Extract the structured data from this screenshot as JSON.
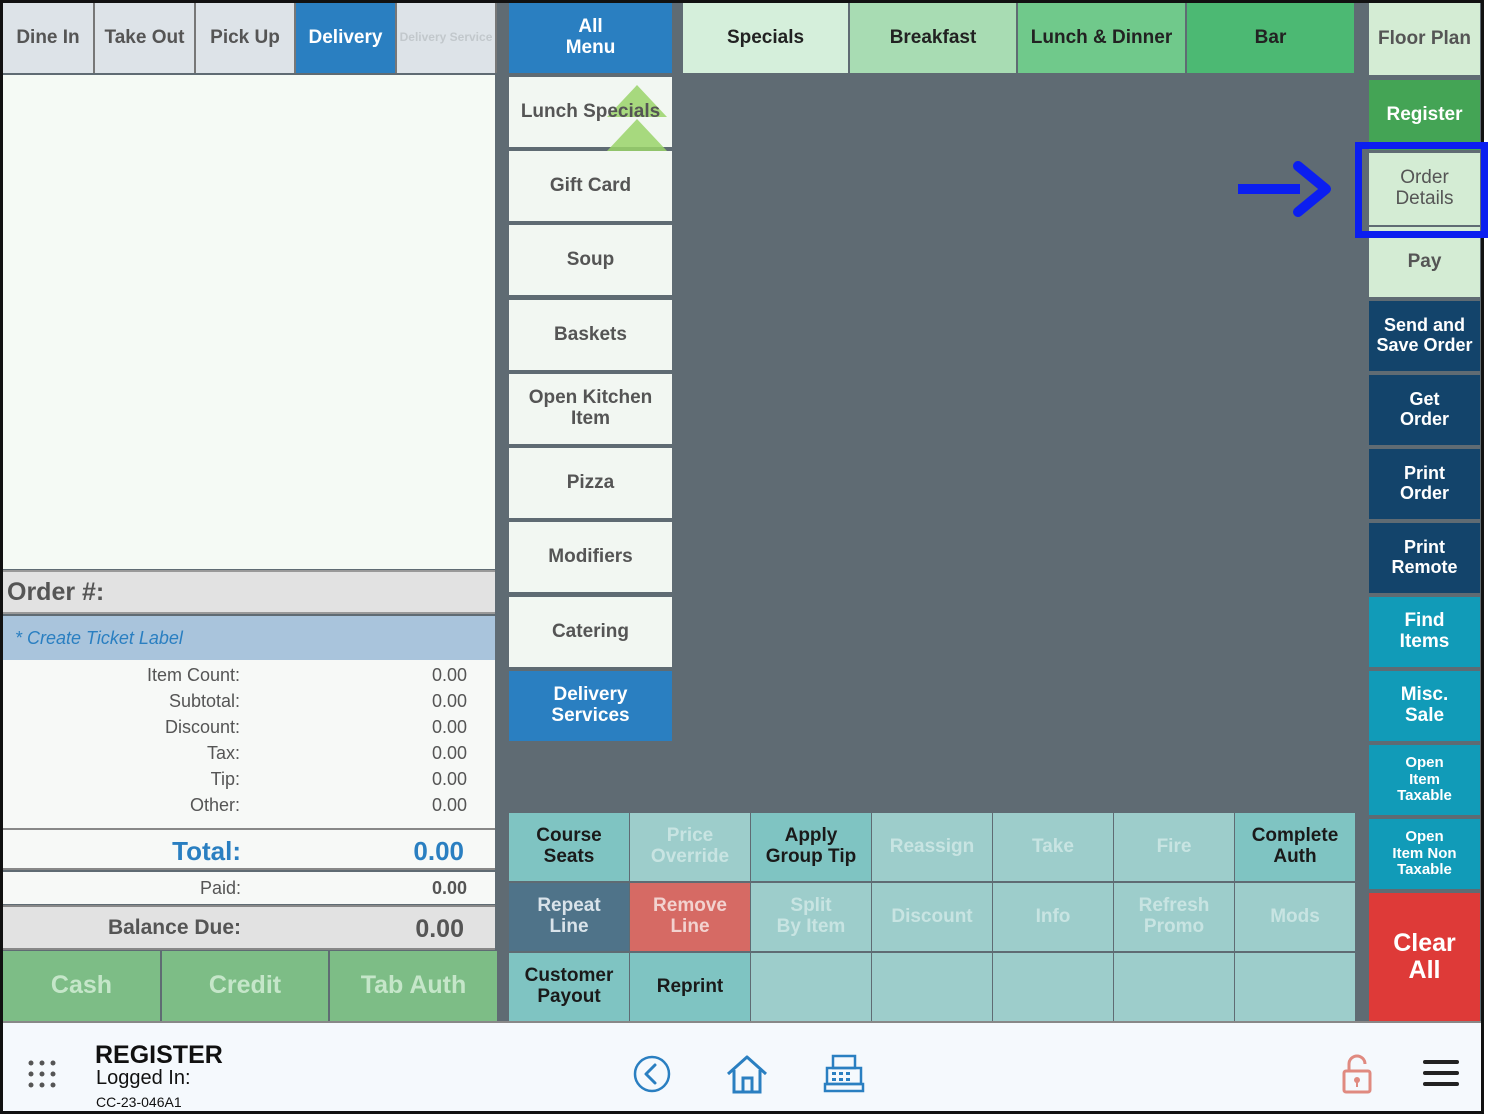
{
  "order_types": [
    {
      "label": "Dine In"
    },
    {
      "label": "Take Out"
    },
    {
      "label": "Pick Up"
    },
    {
      "label": "Delivery"
    },
    {
      "label": "Delivery Service"
    }
  ],
  "menu_tabs": {
    "all_menu": "All\nMenu",
    "items": [
      {
        "label": "Specials",
        "color": "#d5efdb"
      },
      {
        "label": "Breakfast",
        "color": "#a8dcb3"
      },
      {
        "label": "Lunch & Dinner",
        "color": "#70c98b"
      },
      {
        "label": "Bar",
        "color": "#4cb973"
      }
    ]
  },
  "categories": [
    {
      "label": "Lunch Specials"
    },
    {
      "label": "Gift Card"
    },
    {
      "label": "Soup"
    },
    {
      "label": "Baskets"
    },
    {
      "label": "Open Kitchen\nItem"
    },
    {
      "label": "Pizza"
    },
    {
      "label": "Modifiers"
    },
    {
      "label": "Catering"
    },
    {
      "label": "Delivery\nServices"
    }
  ],
  "order": {
    "header": "Order #:",
    "ticket_label": "* Create Ticket Label",
    "lines": [
      {
        "label": "Item Count:",
        "value": "0.00"
      },
      {
        "label": "Subtotal:",
        "value": "0.00"
      },
      {
        "label": "Discount:",
        "value": "0.00"
      },
      {
        "label": "Tax:",
        "value": "0.00"
      },
      {
        "label": "Tip:",
        "value": "0.00"
      },
      {
        "label": "Other:",
        "value": "0.00"
      }
    ],
    "total_label": "Total:",
    "total_value": "0.00",
    "paid_label": "Paid:",
    "paid_value": "0.00",
    "balance_label": "Balance Due:",
    "balance_value": "0.00"
  },
  "payment_buttons": {
    "cash": "Cash",
    "credit": "Credit",
    "tab_auth": "Tab Auth"
  },
  "functions": {
    "row1": [
      "Course\nSeats",
      "Price\nOverride",
      "Apply\nGroup Tip",
      "Reassign",
      "Take",
      "Fire",
      "Complete\nAuth"
    ],
    "row2": [
      "Repeat\nLine",
      "Remove\nLine",
      "Split\nBy Item",
      "Discount",
      "Info",
      "Refresh\nPromo",
      "Mods"
    ],
    "row3": [
      "Customer\nPayout",
      "Reprint"
    ]
  },
  "right_column": {
    "floor_plan": "Floor Plan",
    "register": "Register",
    "order_details": "Order\nDetails",
    "pay": "Pay",
    "send_save": "Send and\nSave Order",
    "get_order": "Get\nOrder",
    "print_order": "Print\nOrder",
    "print_remote": "Print\nRemote",
    "find_items": "Find\nItems",
    "misc_sale": "Misc.\nSale",
    "open_taxable": "Open\nItem\nTaxable",
    "open_non_taxable": "Open\nItem Non\nTaxable",
    "clear_all": "Clear\nAll"
  },
  "footer": {
    "mode": "REGISTER",
    "logged_in": "Logged In:",
    "device_id": "CC-23-046A1"
  },
  "annotation": {
    "highlight_color": "#0b1ef0"
  }
}
